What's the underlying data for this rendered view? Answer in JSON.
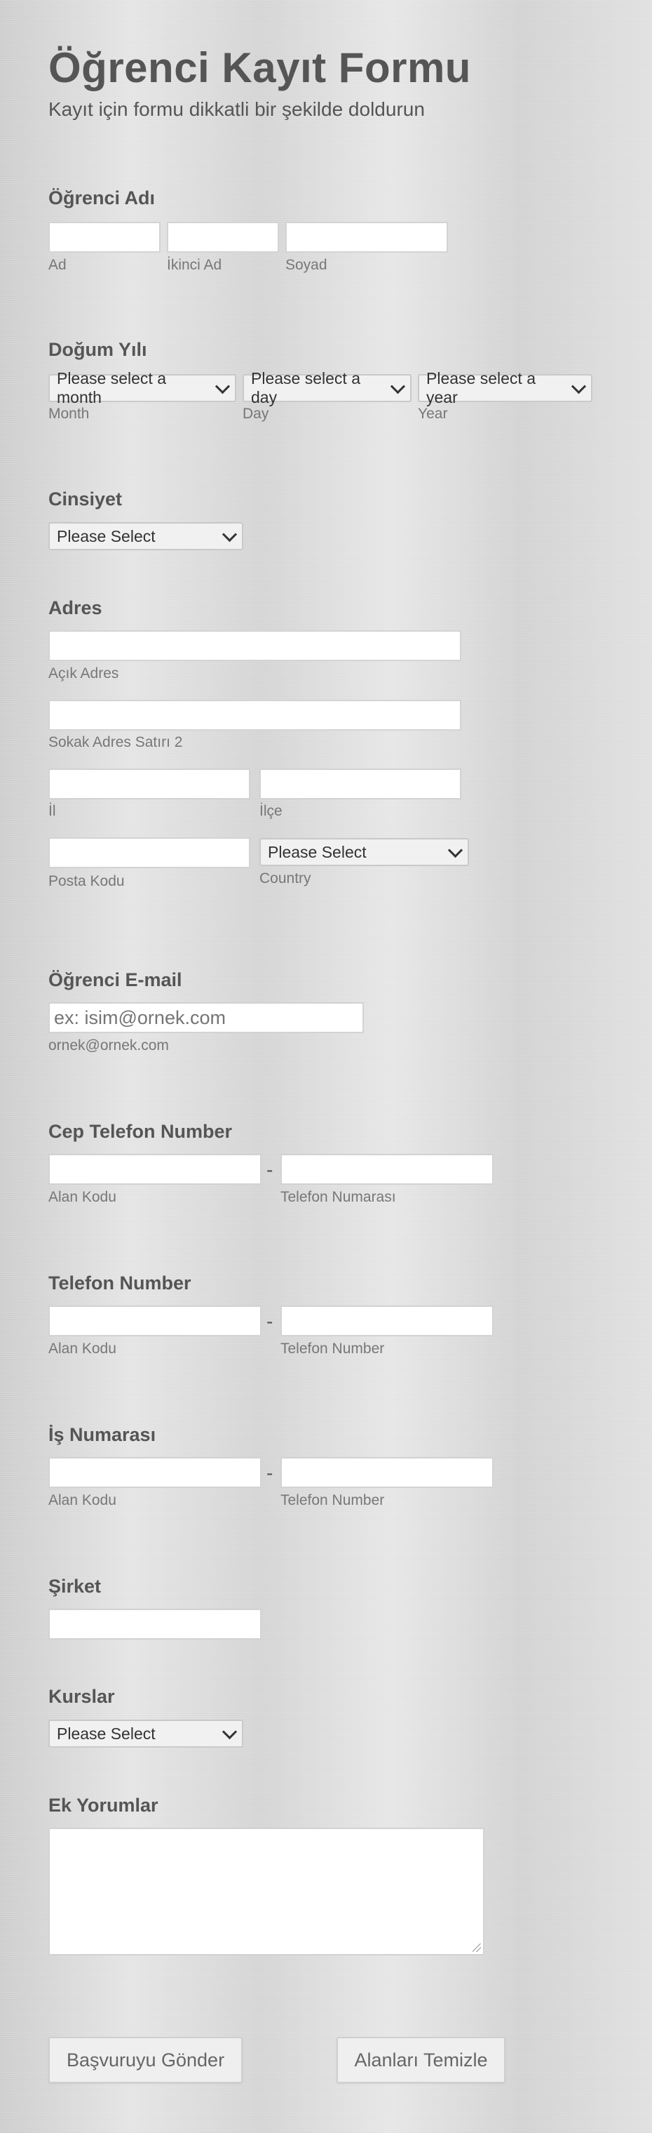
{
  "header": {
    "title": "Öğrenci Kayıt Formu",
    "subtitle": "Kayıt için formu dikkatli bir şekilde doldurun"
  },
  "student_name": {
    "label": "Öğrenci Adı",
    "first_sub": "Ad",
    "middle_sub": "İkinci Ad",
    "last_sub": "Soyad"
  },
  "birth": {
    "label": "Doğum Yılı",
    "month_placeholder": "Please select a month",
    "day_placeholder": "Please select a day",
    "year_placeholder": "Please select a year",
    "month_sub": "Month",
    "day_sub": "Day",
    "year_sub": "Year"
  },
  "gender": {
    "label": "Cinsiyet",
    "selected": "Please Select"
  },
  "address": {
    "label": "Adres",
    "line1_sub": "Açık Adres",
    "line2_sub": "Sokak Adres Satırı 2",
    "city_sub": "İl",
    "district_sub": "İlçe",
    "postal_sub": "Posta Kodu",
    "country_selected": "Please Select",
    "country_sub": "Country"
  },
  "email": {
    "label": "Öğrenci E-mail",
    "placeholder": "ex: isim@ornek.com",
    "sub": "ornek@ornek.com"
  },
  "mobile": {
    "label": "Cep Telefon Number",
    "area_sub": "Alan Kodu",
    "number_sub": "Telefon Numarası",
    "separator": "-"
  },
  "phone": {
    "label": "Telefon Number",
    "area_sub": "Alan Kodu",
    "number_sub": "Telefon Number",
    "separator": "-"
  },
  "work": {
    "label": "İş Numarası",
    "area_sub": "Alan Kodu",
    "number_sub": "Telefon Number",
    "separator": "-"
  },
  "company": {
    "label": "Şirket"
  },
  "courses": {
    "label": "Kurslar",
    "selected": "Please Select"
  },
  "comments": {
    "label": "Ek Yorumlar"
  },
  "buttons": {
    "submit": "Başvuruyu Gönder",
    "clear": "Alanları Temizle"
  }
}
